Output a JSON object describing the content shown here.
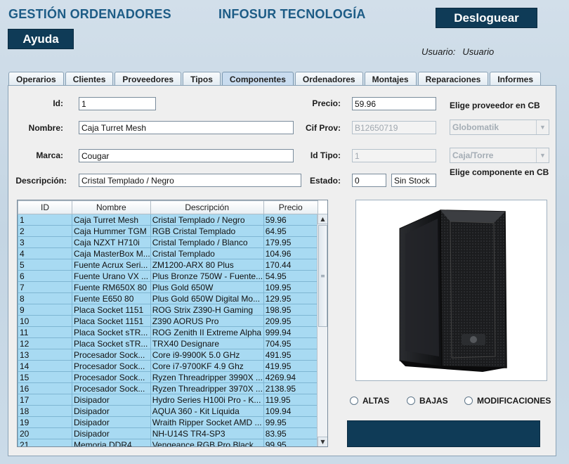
{
  "header": {
    "app_title": "GESTIÓN ORDENADORES",
    "company": "INFOSUR TECNOLOGÍA",
    "logout_label": "Desloguear",
    "help_label": "Ayuda",
    "user_label": "Usuario:",
    "user_name": "Usuario"
  },
  "tabs": [
    {
      "label": "Operarios"
    },
    {
      "label": "Clientes"
    },
    {
      "label": "Proveedores"
    },
    {
      "label": "Tipos"
    },
    {
      "label": "Componentes",
      "active": true
    },
    {
      "label": "Ordenadores"
    },
    {
      "label": "Montajes"
    },
    {
      "label": "Reparaciones"
    },
    {
      "label": "Informes"
    }
  ],
  "form": {
    "id_label": "Id:",
    "id_value": "1",
    "nombre_label": "Nombre:",
    "nombre_value": "Caja Turret Mesh",
    "marca_label": "Marca:",
    "marca_value": "Cougar",
    "descripcion_label": "Descripción:",
    "descripcion_value": "Cristal Templado / Negro",
    "precio_label": "Precio:",
    "precio_value": "59.96",
    "cifprov_label": "Cif Prov:",
    "cifprov_value": "B12650719",
    "idtipo_label": "Id Tipo:",
    "idtipo_value": "1",
    "estado_label": "Estado:",
    "estado_value": "0",
    "estado_text": "Sin Stock",
    "prov_cb_label": "Elige proveedor en CB",
    "prov_cb_value": "Globomatik",
    "comp_cb_label": "Elige componente en CB",
    "comp_cb_value": "Caja/Torre"
  },
  "table": {
    "columns": [
      "ID",
      "Nombre",
      "Descripción",
      "Precio"
    ],
    "rows": [
      [
        "1",
        "Caja Turret Mesh",
        "Cristal Templado / Negro",
        "59.96"
      ],
      [
        "2",
        "Caja Hummer TGM",
        "RGB Cristal Templado",
        "64.95"
      ],
      [
        "3",
        "Caja NZXT H710i",
        " Cristal Templado / Blanco",
        "179.95"
      ],
      [
        "4",
        "Caja MasterBox M...",
        "Cristal Templado",
        "104.96"
      ],
      [
        "5",
        "Fuente Acrux Seri...",
        "ZM1200-ARX 80 Plus",
        "170.44"
      ],
      [
        "6",
        "Fuente Urano VX ...",
        "Plus Bronze 750W - Fuente...",
        "54.95"
      ],
      [
        "7",
        "Fuente RM650X 80",
        "Plus Gold 650W",
        "109.95"
      ],
      [
        "8",
        "Fuente E650 80",
        "Plus Gold 650W Digital Mo...",
        "129.95"
      ],
      [
        "9",
        "Placa Socket 1151",
        "ROG Strix Z390-H Gaming",
        "198.95"
      ],
      [
        "10",
        "Placa Socket 1151",
        "Z390 AORUS Pro",
        "209.95"
      ],
      [
        "11",
        "Placa Socket sTR...",
        "ROG Zenith II Extreme Alpha",
        "999.94"
      ],
      [
        "12",
        "Placa Socket sTR...",
        "TRX40 Designare",
        "704.95"
      ],
      [
        "13",
        "Procesador Sock...",
        "Core i9-9900K 5.0 GHz",
        "491.95"
      ],
      [
        "14",
        "Procesador Sock...",
        "Core i7-9700KF 4.9 Ghz",
        "419.95"
      ],
      [
        "15",
        "Procesador Sock...",
        "Ryzen Threadripper 3990X ...",
        "4269.94"
      ],
      [
        "16",
        "Procesador Sock...",
        "Ryzen Threadripper 3970X ...",
        "2138.95"
      ],
      [
        "17",
        "Disipador",
        "Hydro Series H100i Pro - K...",
        "119.95"
      ],
      [
        "18",
        "Disipador",
        "AQUA 360 - Kit Líquida",
        "109.94"
      ],
      [
        "19",
        "Disipador",
        "Wraith Ripper Socket AMD ...",
        "99.95"
      ],
      [
        "20",
        "Disipador",
        "NH-U14S TR4-SP3",
        "83.95"
      ],
      [
        "21",
        "Memoria DDR4",
        "Vengeance RGB Pro Black",
        "99.95"
      ]
    ]
  },
  "radios": {
    "altas": "ALTAS",
    "bajas": "BAJAS",
    "modificaciones": "MODIFICACIONES"
  }
}
